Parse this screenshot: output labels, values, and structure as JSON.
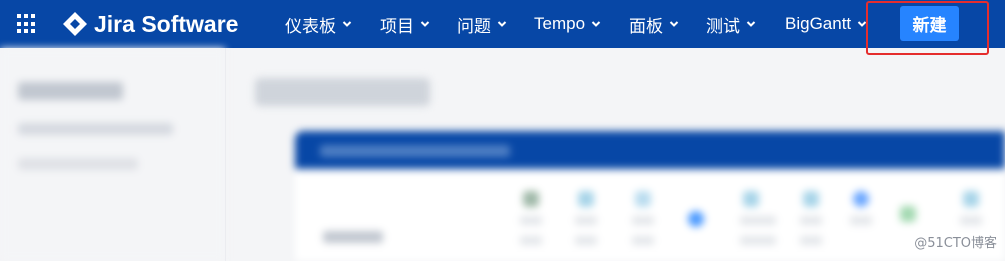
{
  "app": {
    "product_name": "Jira Software"
  },
  "nav": {
    "items": [
      {
        "label": "仪表板"
      },
      {
        "label": "项目"
      },
      {
        "label": "问题"
      },
      {
        "label": "Tempo"
      },
      {
        "label": "面板"
      },
      {
        "label": "测试"
      },
      {
        "label": "BigGantt"
      }
    ],
    "create_label": "新建"
  },
  "colors": {
    "nav_background": "#0747a6",
    "create_button": "#2684ff",
    "highlight_box": "#e52d2d"
  },
  "icons": {
    "app_switcher": "grid-icon",
    "logo": "jira-diamond-icon",
    "dropdown": "chevron-down-icon"
  },
  "watermark": "@51CTO博客"
}
